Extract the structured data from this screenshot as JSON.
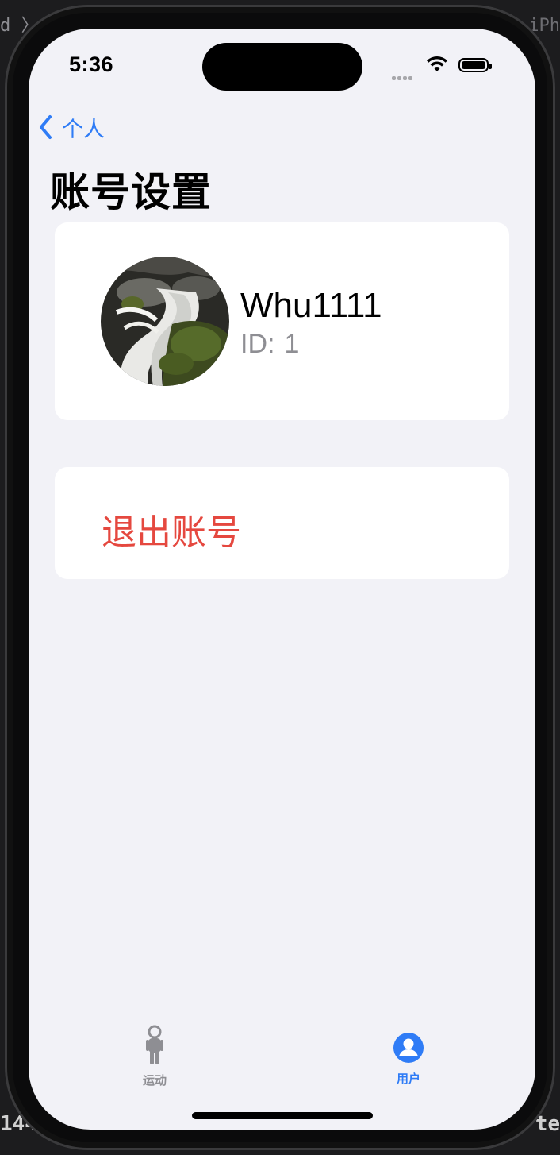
{
  "status_bar": {
    "time": "5:36"
  },
  "nav": {
    "back_label": "个人",
    "title": "账号设置"
  },
  "profile": {
    "username": "Whu1111",
    "id_label": "ID:",
    "id_value": "1"
  },
  "logout": {
    "label": "退出账号"
  },
  "tab_bar": {
    "items": [
      {
        "label": "运动",
        "icon": "figure-walk-icon",
        "selected": false
      },
      {
        "label": "用户",
        "icon": "person-circle-icon",
        "selected": true
      }
    ]
  },
  "colors": {
    "accent": "#2f7cf6",
    "destructive": "#e5483f",
    "background": "#f2f2f7",
    "card": "#ffffff",
    "secondary_text": "#8e8e93"
  }
}
